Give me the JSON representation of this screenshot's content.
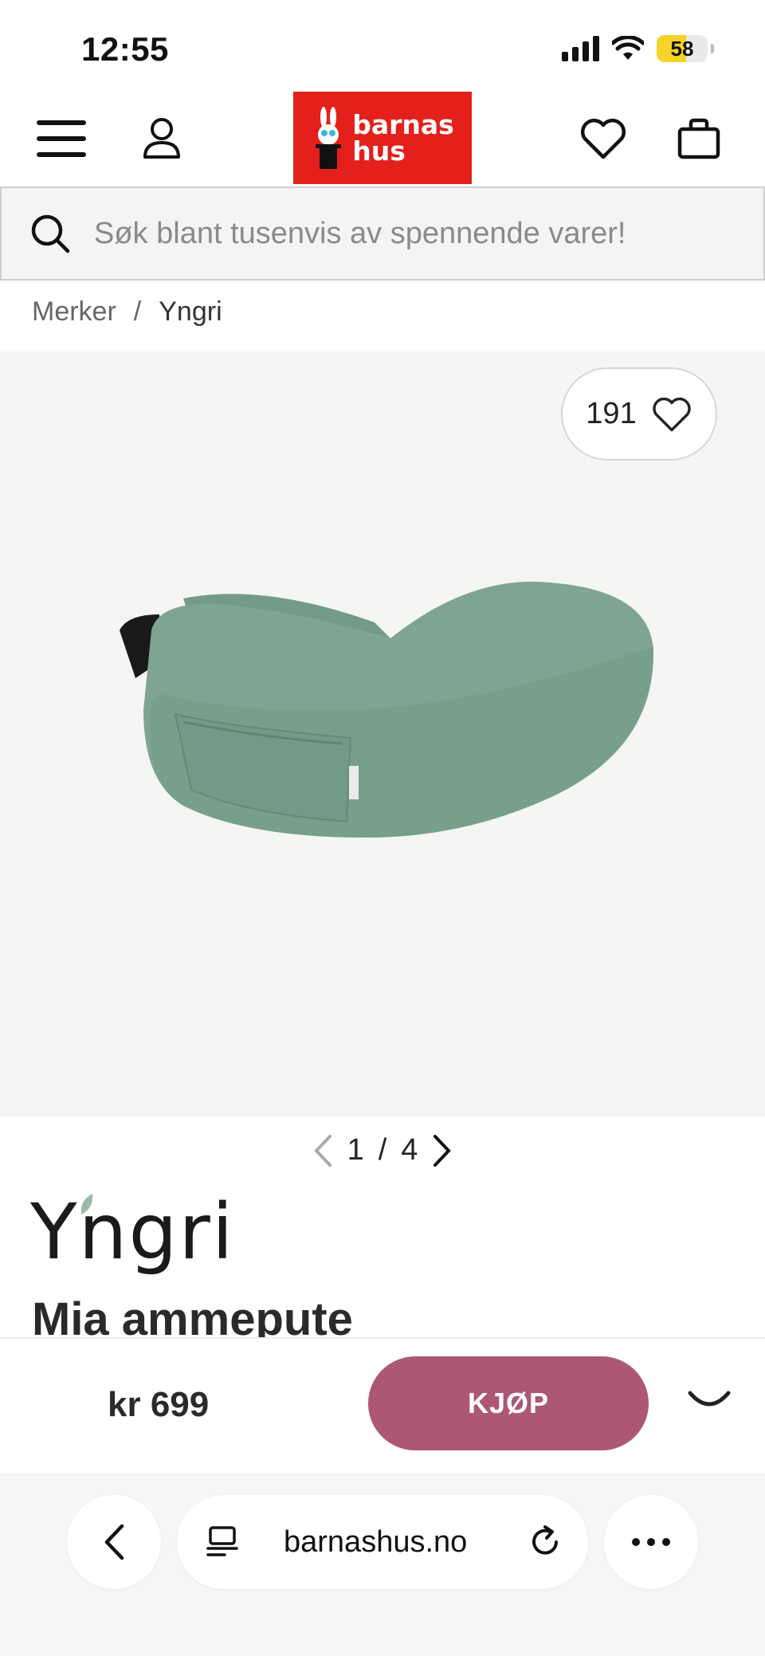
{
  "status_bar": {
    "time": "12:55",
    "battery": "58",
    "battery_level": 0.58
  },
  "header": {
    "logo_line1": "barnas",
    "logo_line2": "hus",
    "brand_color": "#e3201b"
  },
  "search": {
    "placeholder": "Søk blant tusenvis av spennende varer!"
  },
  "breadcrumb": {
    "items": [
      "Merker",
      "Yngri"
    ],
    "separator": "/"
  },
  "product": {
    "favorite_count": "191",
    "image_index": "1",
    "image_total": "4",
    "image_separator": "/",
    "brand": "Yngri",
    "title": "Mia ammepute",
    "pillow_color": "#7fa592"
  },
  "buy_bar": {
    "price": "kr 699",
    "buy_label": "KJØP",
    "buy_color": "#ac5776"
  },
  "browser": {
    "url": "barnashus.no"
  }
}
